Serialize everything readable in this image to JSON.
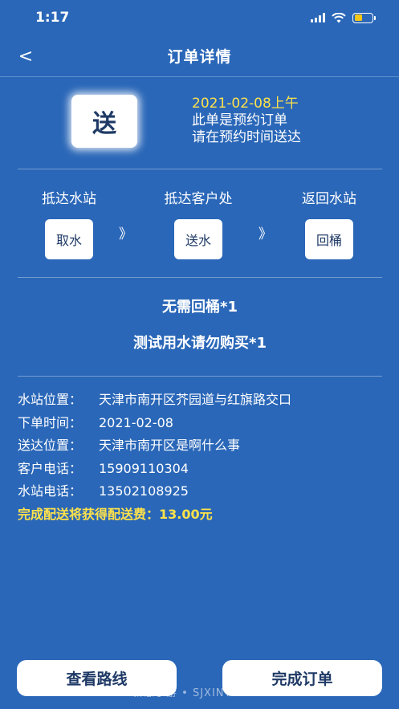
{
  "status": {
    "time": "1:17"
  },
  "nav": {
    "back": "<",
    "title": "订单详情"
  },
  "badge": {
    "text": "送"
  },
  "order": {
    "date": "2021-02-08上午",
    "line1": "此单是预约订单",
    "line2": "请在预约时间送达"
  },
  "steps": [
    {
      "label": "抵达水站",
      "button": "取水"
    },
    {
      "label": "抵达客户处",
      "button": "送水"
    },
    {
      "label": "返回水站",
      "button": "回桶"
    }
  ],
  "step_arrow": "》",
  "items": [
    "无需回桶*1",
    "测试用水请勿购买*1"
  ],
  "details": [
    {
      "label": "水站位置：",
      "value": "天津市南开区芥园道与红旗路交口"
    },
    {
      "label": "下单时间：",
      "value": "2021-02-08"
    },
    {
      "label": "送达位置：",
      "value": "天津市南开区是啊什么事"
    },
    {
      "label": "客户电话：",
      "value": "15909110304"
    },
    {
      "label": "水站电话：",
      "value": "13502108925"
    }
  ],
  "fee": {
    "label": "完成配送将获得配送费：",
    "value": "13.00元"
  },
  "buttons": {
    "route": "查看路线",
    "complete": "完成订单"
  },
  "watermark": "新意手游 • SJXINYI.COM",
  "colors": {
    "background": "#2a67b8",
    "accent_yellow": "#ffe24a",
    "badge_text": "#1f3a66"
  }
}
